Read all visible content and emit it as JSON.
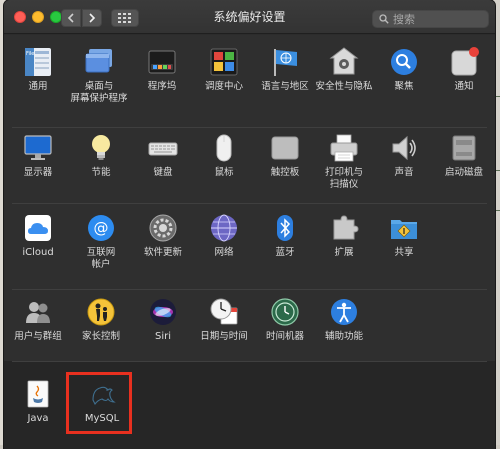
{
  "window": {
    "title": "系统偏好设置",
    "search_placeholder": "搜索"
  },
  "rows": [
    [
      {
        "label": "通用",
        "icon": "general-icon"
      },
      {
        "label": "桌面与\n屏幕保护程序",
        "icon": "desktop-screensaver-icon"
      },
      {
        "label": "程序坞",
        "icon": "dock-icon"
      },
      {
        "label": "调度中心",
        "icon": "mission-control-icon"
      },
      {
        "label": "语言与地区",
        "icon": "language-region-icon"
      },
      {
        "label": "安全性与隐私",
        "icon": "security-privacy-icon"
      },
      {
        "label": "聚焦",
        "icon": "spotlight-icon"
      },
      {
        "label": "通知",
        "icon": "notifications-icon"
      }
    ],
    [
      {
        "label": "显示器",
        "icon": "displays-icon"
      },
      {
        "label": "节能",
        "icon": "energy-saver-icon"
      },
      {
        "label": "键盘",
        "icon": "keyboard-icon"
      },
      {
        "label": "鼠标",
        "icon": "mouse-icon"
      },
      {
        "label": "触控板",
        "icon": "trackpad-icon"
      },
      {
        "label": "打印机与\n扫描仪",
        "icon": "printers-scanners-icon"
      },
      {
        "label": "声音",
        "icon": "sound-icon"
      },
      {
        "label": "启动磁盘",
        "icon": "startup-disk-icon"
      }
    ],
    [
      {
        "label": "iCloud",
        "icon": "icloud-icon"
      },
      {
        "label": "互联网\n帐户",
        "icon": "internet-accounts-icon"
      },
      {
        "label": "软件更新",
        "icon": "software-update-icon"
      },
      {
        "label": "网络",
        "icon": "network-icon"
      },
      {
        "label": "蓝牙",
        "icon": "bluetooth-icon"
      },
      {
        "label": "扩展",
        "icon": "extensions-icon"
      },
      {
        "label": "共享",
        "icon": "sharing-icon"
      }
    ],
    [
      {
        "label": "用户与群组",
        "icon": "users-groups-icon"
      },
      {
        "label": "家长控制",
        "icon": "parental-controls-icon"
      },
      {
        "label": "Siri",
        "icon": "siri-icon"
      },
      {
        "label": "日期与时间",
        "icon": "date-time-icon"
      },
      {
        "label": "时间机器",
        "icon": "time-machine-icon"
      },
      {
        "label": "辅助功能",
        "icon": "accessibility-icon"
      }
    ],
    [
      {
        "label": "Java",
        "icon": "java-icon"
      },
      {
        "label": "MySQL",
        "icon": "mysql-icon"
      }
    ]
  ],
  "colors": {
    "highlight": "#e8301f",
    "window_bg": "#2f2f2f",
    "accent_blue": "#2d8cf0"
  }
}
